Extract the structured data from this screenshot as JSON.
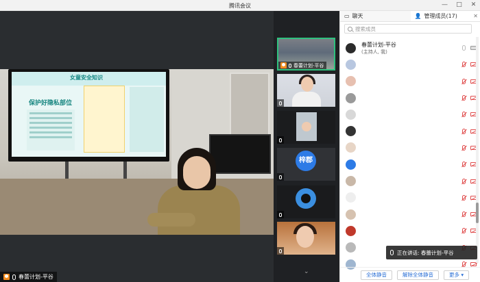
{
  "window": {
    "title": "腾讯会议",
    "minimize_icon": "minimize-icon",
    "maximize_icon": "maximize-icon",
    "close_icon": "close-icon"
  },
  "main_video": {
    "speaker_name": "春蕾计划-平谷",
    "slide_title": "女童安全知识",
    "slide_heading": "保护好隐私部位"
  },
  "thumbnails": [
    {
      "name": "春蕾计划-平谷",
      "active": true
    },
    {
      "name": ""
    },
    {
      "name": ""
    },
    {
      "name": "",
      "avatar_text": "梓郡"
    },
    {
      "name": ""
    },
    {
      "name": ""
    }
  ],
  "panel": {
    "tabs": {
      "chat": "聊天",
      "members": "管理成员(17)"
    },
    "search_placeholder": "搜索成员",
    "members": [
      {
        "name": "春蕾计划-平谷",
        "role": "(主持人, 我)",
        "avatar_color": "#2b2b2b",
        "mic": "on",
        "cam": "on"
      },
      {
        "name": "",
        "avatar_color": "#b8c7e0",
        "mic": "off",
        "cam": "off"
      },
      {
        "name": "",
        "avatar_color": "#e7c0b0",
        "mic": "off",
        "cam": "off"
      },
      {
        "name": "",
        "avatar_color": "#9a9a9a",
        "mic": "off",
        "cam": "off"
      },
      {
        "name": "",
        "avatar_color": "#d8d8d8",
        "mic": "off",
        "cam": "off"
      },
      {
        "name": "",
        "avatar_color": "#333333",
        "mic": "off",
        "cam": "off"
      },
      {
        "name": "",
        "avatar_color": "#e7d5c6",
        "mic": "off",
        "cam": "off"
      },
      {
        "name": "",
        "avatar_color": "#2d7be6",
        "mic": "off",
        "cam": "off"
      },
      {
        "name": "",
        "avatar_color": "#c9b8a8",
        "mic": "off",
        "cam": "off"
      },
      {
        "name": "",
        "avatar_color": "#eeeeee",
        "mic": "off",
        "cam": "off"
      },
      {
        "name": "",
        "avatar_color": "#d6c2b0",
        "mic": "off",
        "cam": "off"
      },
      {
        "name": "",
        "avatar_color": "#c0392b",
        "mic": "off",
        "cam": "off"
      },
      {
        "name": "",
        "avatar_color": "#b9b9b9",
        "mic": "off",
        "cam": "off"
      },
      {
        "name": "",
        "avatar_color": "#9fb6d0",
        "mic": "off",
        "cam": "off"
      }
    ],
    "speaking_label": "正在讲话: 春蕾计划-平谷",
    "buttons": {
      "mute_all": "全体静音",
      "unmute_all": "解除全体静音",
      "more": "更多"
    }
  },
  "colors": {
    "accent": "#2a6fd6",
    "active_thumb": "#2ec27e",
    "host_badge": "#f28b1e",
    "muted": "#e04a4a"
  }
}
